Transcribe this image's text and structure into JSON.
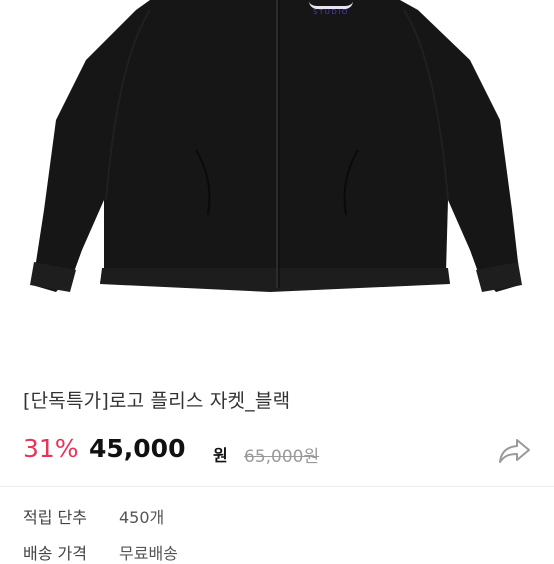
{
  "product": {
    "image_alt_icon": "fleece-jacket-photo",
    "logo_subtext": "STUDIO",
    "title": "[단독특가]로고 플리스 자켓_블랙",
    "discount": "31%",
    "sale_price": "45,000",
    "currency": "원",
    "original_price": "65,000원",
    "share_icon": "share-icon"
  },
  "info": [
    {
      "label": "적립 단추",
      "value": "450개"
    },
    {
      "label": "배송 가격",
      "value": "무료배송"
    }
  ],
  "colors": {
    "discount": "#e8345a",
    "jacket": "#161616",
    "logo_blue": "#4b3bd6"
  }
}
